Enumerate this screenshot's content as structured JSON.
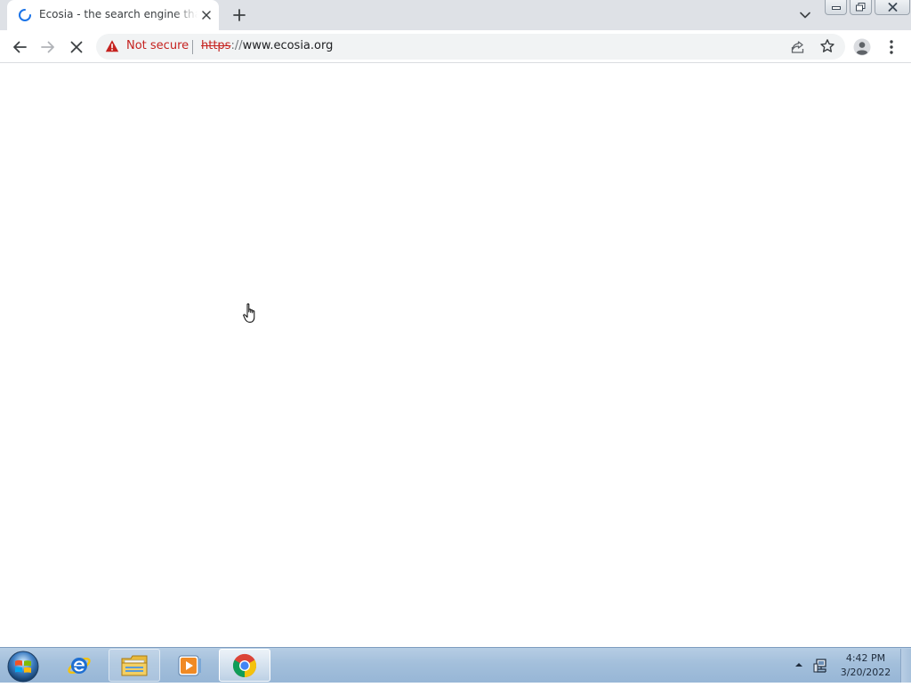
{
  "browser": {
    "tab": {
      "title": "Ecosia - the search engine that plants trees",
      "loading": true
    },
    "new_tab_symbol": "+",
    "toolbar": {
      "security_label": "Not secure",
      "url_scheme": "https",
      "url_separator": "://",
      "url_host": "www.ecosia.org"
    }
  },
  "taskbar": {
    "clock_time": "4:42 PM",
    "clock_date": "3/20/2022",
    "items": [
      {
        "name": "internet-explorer",
        "state": "pinned"
      },
      {
        "name": "windows-explorer",
        "state": "pinned-open"
      },
      {
        "name": "media-player",
        "state": "pinned"
      },
      {
        "name": "chrome",
        "state": "active"
      }
    ]
  },
  "colors": {
    "tabstrip_bg": "#dee1e6",
    "omnibox_bg": "#f1f3f4",
    "not_secure_red": "#c5221f",
    "spinner_blue": "#1a73e8",
    "taskbar_blue": "#a3bfdb"
  }
}
